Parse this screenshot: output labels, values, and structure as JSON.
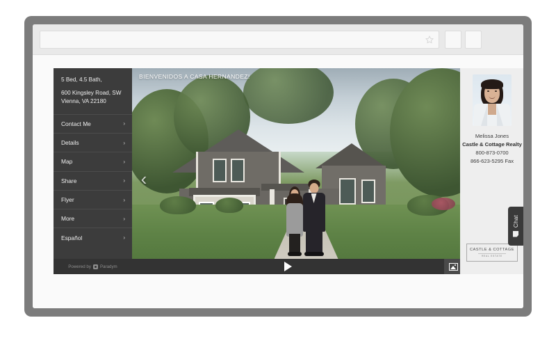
{
  "browser": {
    "url_value": "",
    "url_placeholder": "",
    "star_icon": "star-icon",
    "button1_label": "",
    "button2_label": ""
  },
  "property": {
    "beds_baths": "5 Bed, 4.5 Bath,",
    "address_line1": "600 Kingsley Road, SW",
    "address_line2": "Vienna, VA 22180"
  },
  "menu": {
    "items": [
      {
        "label": "Contact Me",
        "chevron": "›"
      },
      {
        "label": "Details",
        "chevron": "›"
      },
      {
        "label": "Map",
        "chevron": "›"
      },
      {
        "label": "Share",
        "chevron": "›"
      },
      {
        "label": "Flyer",
        "chevron": "›"
      },
      {
        "label": "More",
        "chevron": "›"
      },
      {
        "label": "Español",
        "chevron": "›"
      }
    ]
  },
  "footer": {
    "powered_by": "Powered by",
    "brand": "Paradym"
  },
  "viewer": {
    "overlay_title": "BIENVENIDOS A CASA HERNANDEZ!",
    "prev_arrow": "‹",
    "next_arrow": "›",
    "play_label": "play-button",
    "photo_view_label": "photo-view",
    "grid_view_label": "grid-view"
  },
  "agent": {
    "photo_alt": "agent-headshot",
    "name": "Melissa Jones",
    "company": "Castle & Cottage Realty",
    "phone": "800-873-0700",
    "fax": "866-623-5295 Fax"
  },
  "brand": {
    "name": "CASTLE & COTTAGE",
    "tagline": "REAL ESTATE"
  },
  "chat": {
    "label": "Chat"
  },
  "colors": {
    "bezel": "#7c7c7c",
    "sidebar": "#3c3c3c",
    "controls_bar": "#333333",
    "agent_panel": "#eeeeee",
    "chrome": "#e9e9e9"
  }
}
